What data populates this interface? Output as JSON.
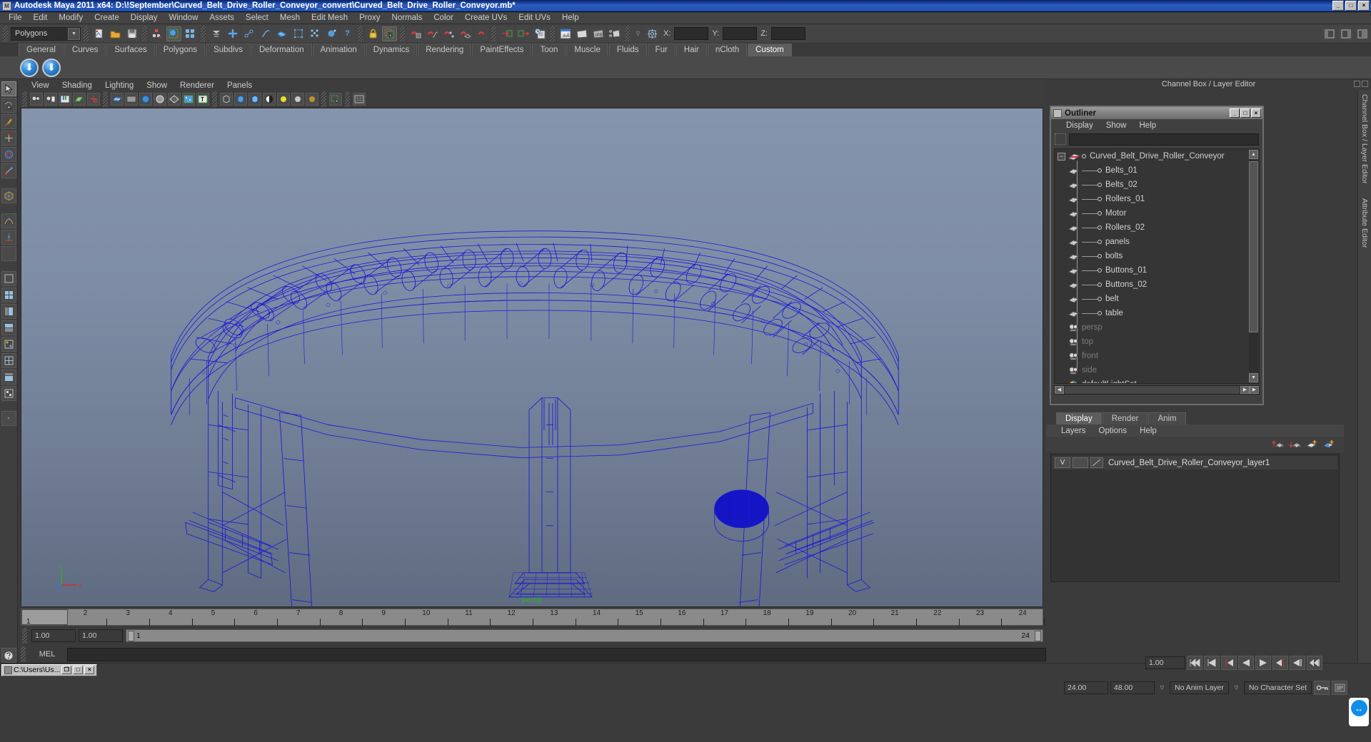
{
  "window": {
    "title": "Autodesk Maya 2011 x64: D:\\!September\\Curved_Belt_Drive_Roller_Conveyor_convert\\Curved_Belt_Drive_Roller_Conveyor.mb*",
    "minimize": "_",
    "maximize": "□",
    "close": "×"
  },
  "menubar": {
    "items": [
      "File",
      "Edit",
      "Modify",
      "Create",
      "Display",
      "Window",
      "Assets",
      "Select",
      "Mesh",
      "Edit Mesh",
      "Proxy",
      "Normals",
      "Color",
      "Create UVs",
      "Edit UVs",
      "Help"
    ]
  },
  "statusline": {
    "mode": "Polygons",
    "mode_arrow": "▼",
    "x_label": "X:",
    "y_label": "Y:",
    "z_label": "Z:",
    "x_value": "",
    "y_value": "",
    "z_value": ""
  },
  "shelf": {
    "tabs": [
      "General",
      "Curves",
      "Surfaces",
      "Polygons",
      "Subdivs",
      "Deformation",
      "Animation",
      "Dynamics",
      "Rendering",
      "PaintEffects",
      "Toon",
      "Muscle",
      "Fluids",
      "Fur",
      "Hair",
      "nCloth",
      "Custom"
    ],
    "selected_tab": "Custom",
    "buttons": [
      "shelf-item-1",
      "shelf-item-2"
    ]
  },
  "viewport": {
    "menu": [
      "View",
      "Shading",
      "Lighting",
      "Show",
      "Renderer",
      "Panels"
    ],
    "camera_label": "persp",
    "axis": {
      "x": "x",
      "y": "y",
      "z": "z"
    }
  },
  "outliner": {
    "title": "Outliner",
    "minimize": "_",
    "maximize": "□",
    "close": "×",
    "menu": [
      "Display",
      "Show",
      "Help"
    ],
    "search_value": "",
    "root": "Curved_Belt_Drive_Roller_Conveyor",
    "expand_glyph": "−",
    "children": [
      "Belts_01",
      "Belts_02",
      "Rollers_01",
      "Motor",
      "Rollers_02",
      "panels",
      "bolts",
      "Buttons_01",
      "Buttons_02",
      "belt",
      "table"
    ],
    "cameras": [
      "persp",
      "top",
      "front",
      "side"
    ],
    "sets": [
      "defaultLightSet"
    ]
  },
  "channelbox": {
    "title": "Channel Box / Layer Editor",
    "side_tabs": [
      "Channel Box / Layer Editor",
      "Attribute Editor"
    ]
  },
  "layer_editor": {
    "tabs": [
      "Display",
      "Render",
      "Anim"
    ],
    "selected_tab": "Display",
    "menu": [
      "Layers",
      "Options",
      "Help"
    ],
    "layers": [
      {
        "visibility": "V",
        "playback": "",
        "name": "Curved_Belt_Drive_Roller_Conveyor_layer1"
      }
    ]
  },
  "timeline": {
    "start_label": "1",
    "current_frame": "1",
    "ticks": [
      "1",
      "2",
      "3",
      "4",
      "5",
      "6",
      "7",
      "8",
      "9",
      "10",
      "11",
      "12",
      "13",
      "14",
      "15",
      "16",
      "17",
      "18",
      "19",
      "20",
      "21",
      "22",
      "23",
      "24"
    ],
    "range_start": "1.00",
    "range_end_field": "1.00",
    "range_bar_start": "1",
    "range_bar_end": "24",
    "anim_start": "24.00",
    "anim_end": "48.00",
    "playback_speed": "1.00",
    "anim_layer": "No Anim Layer",
    "character_set": "No Character Set",
    "anim_layer_arrow": "▽",
    "character_arrow": "▽"
  },
  "playback_buttons": [
    "⏮",
    "⏪",
    "◀‖",
    "◀",
    "▶",
    "‖▶",
    "▶█",
    "⏭"
  ],
  "mel": {
    "label": "MEL",
    "command": ""
  },
  "taskbar": {
    "item_label": "C:\\Users\\Us...",
    "buttons": [
      "❐",
      "□",
      "×"
    ]
  },
  "colors": {
    "title_bar": "#1f4fae",
    "wireframe": "#1414d0",
    "viewport_top": "#8494ac",
    "viewport_bottom": "#5f6b80",
    "persp_text": "#2fae2f",
    "panel_bg": "#3b3b3b"
  }
}
